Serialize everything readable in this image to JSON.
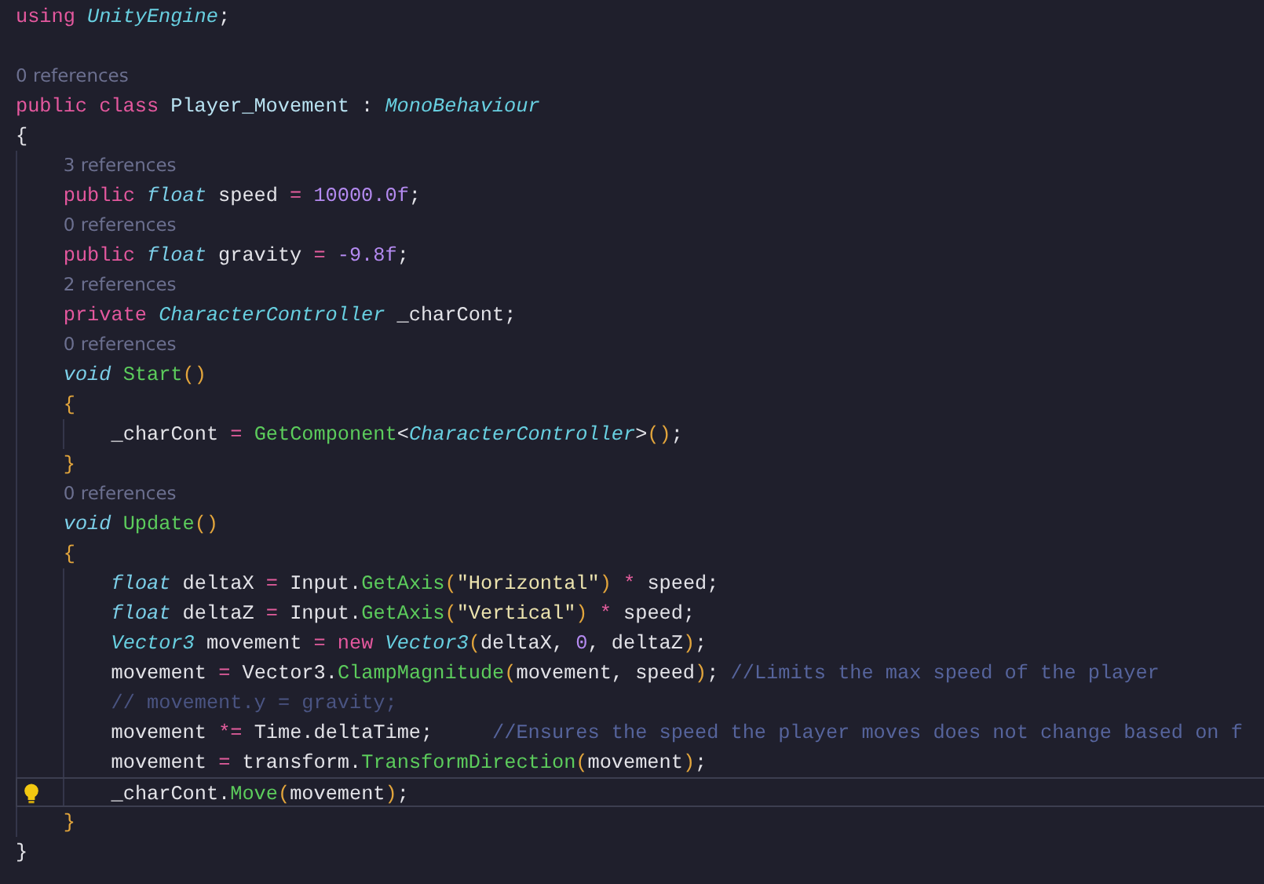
{
  "editor": {
    "lines": [
      {
        "kind": "code",
        "tokens": [
          {
            "text": "using ",
            "kind": "keyword"
          },
          {
            "text": "UnityEngine",
            "kind": "class"
          },
          {
            "text": ";",
            "kind": "plain"
          }
        ]
      },
      {
        "kind": "blank"
      },
      {
        "kind": "codelens",
        "text": "0 references"
      },
      {
        "kind": "code",
        "tokens": [
          {
            "text": "public ",
            "kind": "keyword"
          },
          {
            "text": "class ",
            "kind": "keyword"
          },
          {
            "text": "Player_Movement",
            "kind": "name"
          },
          {
            "text": " : ",
            "kind": "plain"
          },
          {
            "text": "MonoBehaviour",
            "kind": "class"
          }
        ]
      },
      {
        "kind": "code",
        "tokens": [
          {
            "text": "{",
            "kind": "plain"
          }
        ],
        "children": [
          {
            "kind": "codelens",
            "text": "3 references"
          },
          {
            "kind": "code",
            "tokens": [
              {
                "text": "public ",
                "kind": "keyword"
              },
              {
                "text": "float",
                "kind": "typeword"
              },
              {
                "text": " speed ",
                "kind": "plain"
              },
              {
                "text": "= ",
                "kind": "operator"
              },
              {
                "text": "10000.0f",
                "kind": "number"
              },
              {
                "text": ";",
                "kind": "plain"
              }
            ]
          },
          {
            "kind": "codelens",
            "text": "0 references"
          },
          {
            "kind": "code",
            "tokens": [
              {
                "text": "public ",
                "kind": "keyword"
              },
              {
                "text": "float",
                "kind": "typeword"
              },
              {
                "text": " gravity ",
                "kind": "plain"
              },
              {
                "text": "= ",
                "kind": "operator"
              },
              {
                "text": "-9.8f",
                "kind": "number"
              },
              {
                "text": ";",
                "kind": "plain"
              }
            ]
          },
          {
            "kind": "codelens",
            "text": "2 references"
          },
          {
            "kind": "code",
            "tokens": [
              {
                "text": "private ",
                "kind": "keyword"
              },
              {
                "text": "CharacterController",
                "kind": "class"
              },
              {
                "text": " _charCont;",
                "kind": "plain"
              }
            ]
          },
          {
            "kind": "codelens",
            "text": "0 references"
          },
          {
            "kind": "code",
            "tokens": [
              {
                "text": "void",
                "kind": "typeword"
              },
              {
                "text": " Start",
                "kind": "method"
              },
              {
                "text": "()",
                "kind": "bracket"
              }
            ]
          },
          {
            "kind": "code",
            "tokens": [
              {
                "text": "{",
                "kind": "bracket"
              }
            ],
            "children": [
              {
                "kind": "code",
                "tokens": [
                  {
                    "text": "_charCont ",
                    "kind": "plain"
                  },
                  {
                    "text": "= ",
                    "kind": "operator"
                  },
                  {
                    "text": "GetComponent",
                    "kind": "method"
                  },
                  {
                    "text": "<",
                    "kind": "plain"
                  },
                  {
                    "text": "CharacterController",
                    "kind": "class"
                  },
                  {
                    "text": ">",
                    "kind": "plain"
                  },
                  {
                    "text": "()",
                    "kind": "bracket"
                  },
                  {
                    "text": ";",
                    "kind": "plain"
                  }
                ]
              }
            ]
          },
          {
            "kind": "code",
            "tokens": [
              {
                "text": "}",
                "kind": "bracket"
              }
            ]
          },
          {
            "kind": "codelens",
            "text": "0 references"
          },
          {
            "kind": "code",
            "tokens": [
              {
                "text": "void",
                "kind": "typeword"
              },
              {
                "text": " Update",
                "kind": "method"
              },
              {
                "text": "()",
                "kind": "bracket"
              }
            ]
          },
          {
            "kind": "code",
            "tokens": [
              {
                "text": "{",
                "kind": "bracket"
              }
            ],
            "children": [
              {
                "kind": "code",
                "tokens": [
                  {
                    "text": "float",
                    "kind": "typeword"
                  },
                  {
                    "text": " deltaX ",
                    "kind": "plain"
                  },
                  {
                    "text": "=",
                    "kind": "operator"
                  },
                  {
                    "text": " Input.",
                    "kind": "plain"
                  },
                  {
                    "text": "GetAxis",
                    "kind": "method"
                  },
                  {
                    "text": "(",
                    "kind": "bracket"
                  },
                  {
                    "text": "\"Horizontal\"",
                    "kind": "string"
                  },
                  {
                    "text": ") ",
                    "kind": "bracket"
                  },
                  {
                    "text": "*",
                    "kind": "operator"
                  },
                  {
                    "text": " speed;",
                    "kind": "plain"
                  }
                ]
              },
              {
                "kind": "code",
                "tokens": [
                  {
                    "text": "float",
                    "kind": "typeword"
                  },
                  {
                    "text": " deltaZ ",
                    "kind": "plain"
                  },
                  {
                    "text": "=",
                    "kind": "operator"
                  },
                  {
                    "text": " Input.",
                    "kind": "plain"
                  },
                  {
                    "text": "GetAxis",
                    "kind": "method"
                  },
                  {
                    "text": "(",
                    "kind": "bracket"
                  },
                  {
                    "text": "\"Vertical\"",
                    "kind": "string"
                  },
                  {
                    "text": ") ",
                    "kind": "bracket"
                  },
                  {
                    "text": "*",
                    "kind": "operator"
                  },
                  {
                    "text": " speed;",
                    "kind": "plain"
                  }
                ]
              },
              {
                "kind": "code",
                "tokens": [
                  {
                    "text": "Vector3",
                    "kind": "class"
                  },
                  {
                    "text": " movement ",
                    "kind": "plain"
                  },
                  {
                    "text": "= ",
                    "kind": "operator"
                  },
                  {
                    "text": "new ",
                    "kind": "keyword"
                  },
                  {
                    "text": "Vector3",
                    "kind": "class"
                  },
                  {
                    "text": "(",
                    "kind": "bracket"
                  },
                  {
                    "text": "deltaX, ",
                    "kind": "plain"
                  },
                  {
                    "text": "0",
                    "kind": "number"
                  },
                  {
                    "text": ", deltaZ",
                    "kind": "plain"
                  },
                  {
                    "text": ")",
                    "kind": "bracket"
                  },
                  {
                    "text": ";",
                    "kind": "plain"
                  }
                ]
              },
              {
                "kind": "code",
                "tokens": [
                  {
                    "text": "movement ",
                    "kind": "plain"
                  },
                  {
                    "text": "=",
                    "kind": "operator"
                  },
                  {
                    "text": " Vector3.",
                    "kind": "plain"
                  },
                  {
                    "text": "ClampMagnitude",
                    "kind": "method"
                  },
                  {
                    "text": "(",
                    "kind": "bracket"
                  },
                  {
                    "text": "movement, speed",
                    "kind": "plain"
                  },
                  {
                    "text": ")",
                    "kind": "bracket"
                  },
                  {
                    "text": ";",
                    "kind": "plain"
                  },
                  {
                    "text": " //Limits the max speed of the player",
                    "kind": "comment"
                  }
                ]
              },
              {
                "kind": "code",
                "tokens": [
                  {
                    "text": "// movement.y = gravity;",
                    "kind": "disabled"
                  }
                ]
              },
              {
                "kind": "code",
                "tokens": [
                  {
                    "text": "movement ",
                    "kind": "plain"
                  },
                  {
                    "text": "*=",
                    "kind": "operator"
                  },
                  {
                    "text": " Time.deltaTime;     ",
                    "kind": "plain"
                  },
                  {
                    "text": "//Ensures the speed the player moves does not change based on f",
                    "kind": "comment"
                  }
                ]
              },
              {
                "kind": "code",
                "tokens": [
                  {
                    "text": "movement ",
                    "kind": "plain"
                  },
                  {
                    "text": "=",
                    "kind": "operator"
                  },
                  {
                    "text": " transform.",
                    "kind": "plain"
                  },
                  {
                    "text": "TransformDirection",
                    "kind": "method"
                  },
                  {
                    "text": "(",
                    "kind": "bracket"
                  },
                  {
                    "text": "movement",
                    "kind": "plain"
                  },
                  {
                    "text": ")",
                    "kind": "bracket"
                  },
                  {
                    "text": ";",
                    "kind": "plain"
                  }
                ]
              },
              {
                "kind": "current",
                "tokens": [
                  {
                    "text": "_charCont.",
                    "kind": "plain"
                  },
                  {
                    "text": "Move",
                    "kind": "method"
                  },
                  {
                    "text": "(",
                    "kind": "bracket"
                  },
                  {
                    "text": "movement",
                    "kind": "plain"
                  },
                  {
                    "text": ")",
                    "kind": "bracket"
                  },
                  {
                    "text": ";",
                    "kind": "plain"
                  }
                ]
              }
            ]
          },
          {
            "kind": "code",
            "tokens": [
              {
                "text": "}",
                "kind": "bracket"
              }
            ]
          }
        ]
      },
      {
        "kind": "code",
        "tokens": [
          {
            "text": "}",
            "kind": "plain"
          }
        ]
      }
    ]
  }
}
